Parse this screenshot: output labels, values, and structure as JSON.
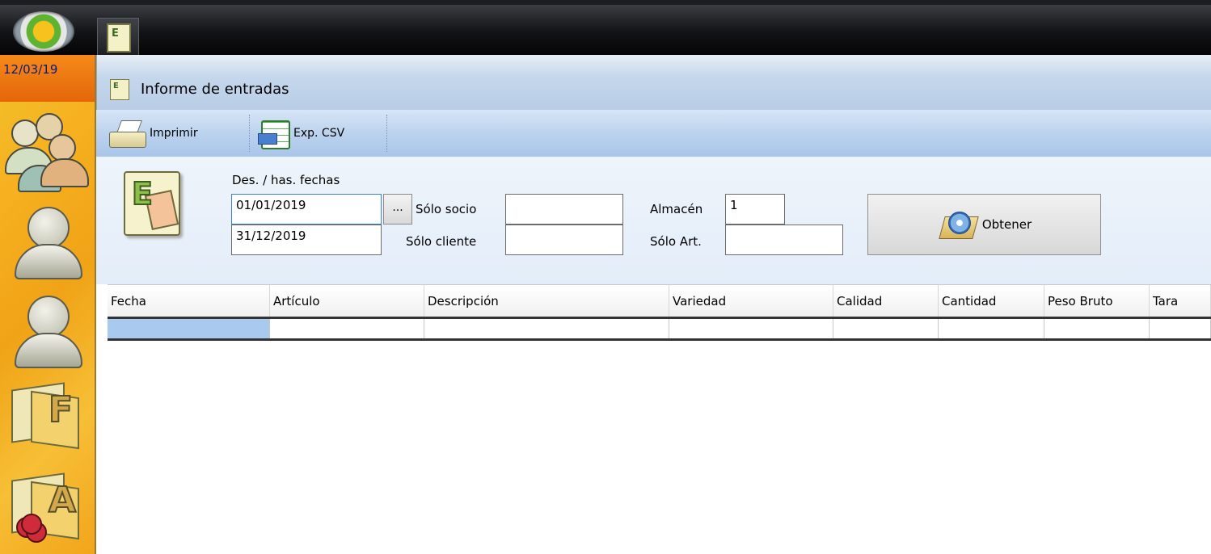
{
  "app": {
    "date": "12/03/19"
  },
  "window": {
    "title": "Informe de entradas"
  },
  "toolbar": {
    "print_label": "Imprimir",
    "csv_label": "Exp. CSV"
  },
  "filters": {
    "dates_label": "Des. / has. fechas",
    "date_from": "01/01/2019",
    "date_to": "31/12/2019",
    "dots_label": "...",
    "socio_label": "Sólo socio",
    "socio_value": "",
    "cliente_label": "Sólo cliente",
    "cliente_value": "",
    "almacen_label": "Almacén",
    "almacen_value": "1",
    "articulo_label": "Sólo Art.",
    "articulo_value": "",
    "obtener_label": "Obtener"
  },
  "grid": {
    "columns": [
      "Fecha",
      "Artículo",
      "Descripción",
      "Variedad",
      "Calidad",
      "Cantidad",
      "Peso Bruto",
      "Tara"
    ]
  },
  "icons": {
    "sidebar": [
      "group-users-icon",
      "user-icon",
      "user-icon",
      "document-f-icon",
      "document-a-icon"
    ],
    "toolbar": [
      "printer-icon",
      "csv-export-icon"
    ]
  }
}
